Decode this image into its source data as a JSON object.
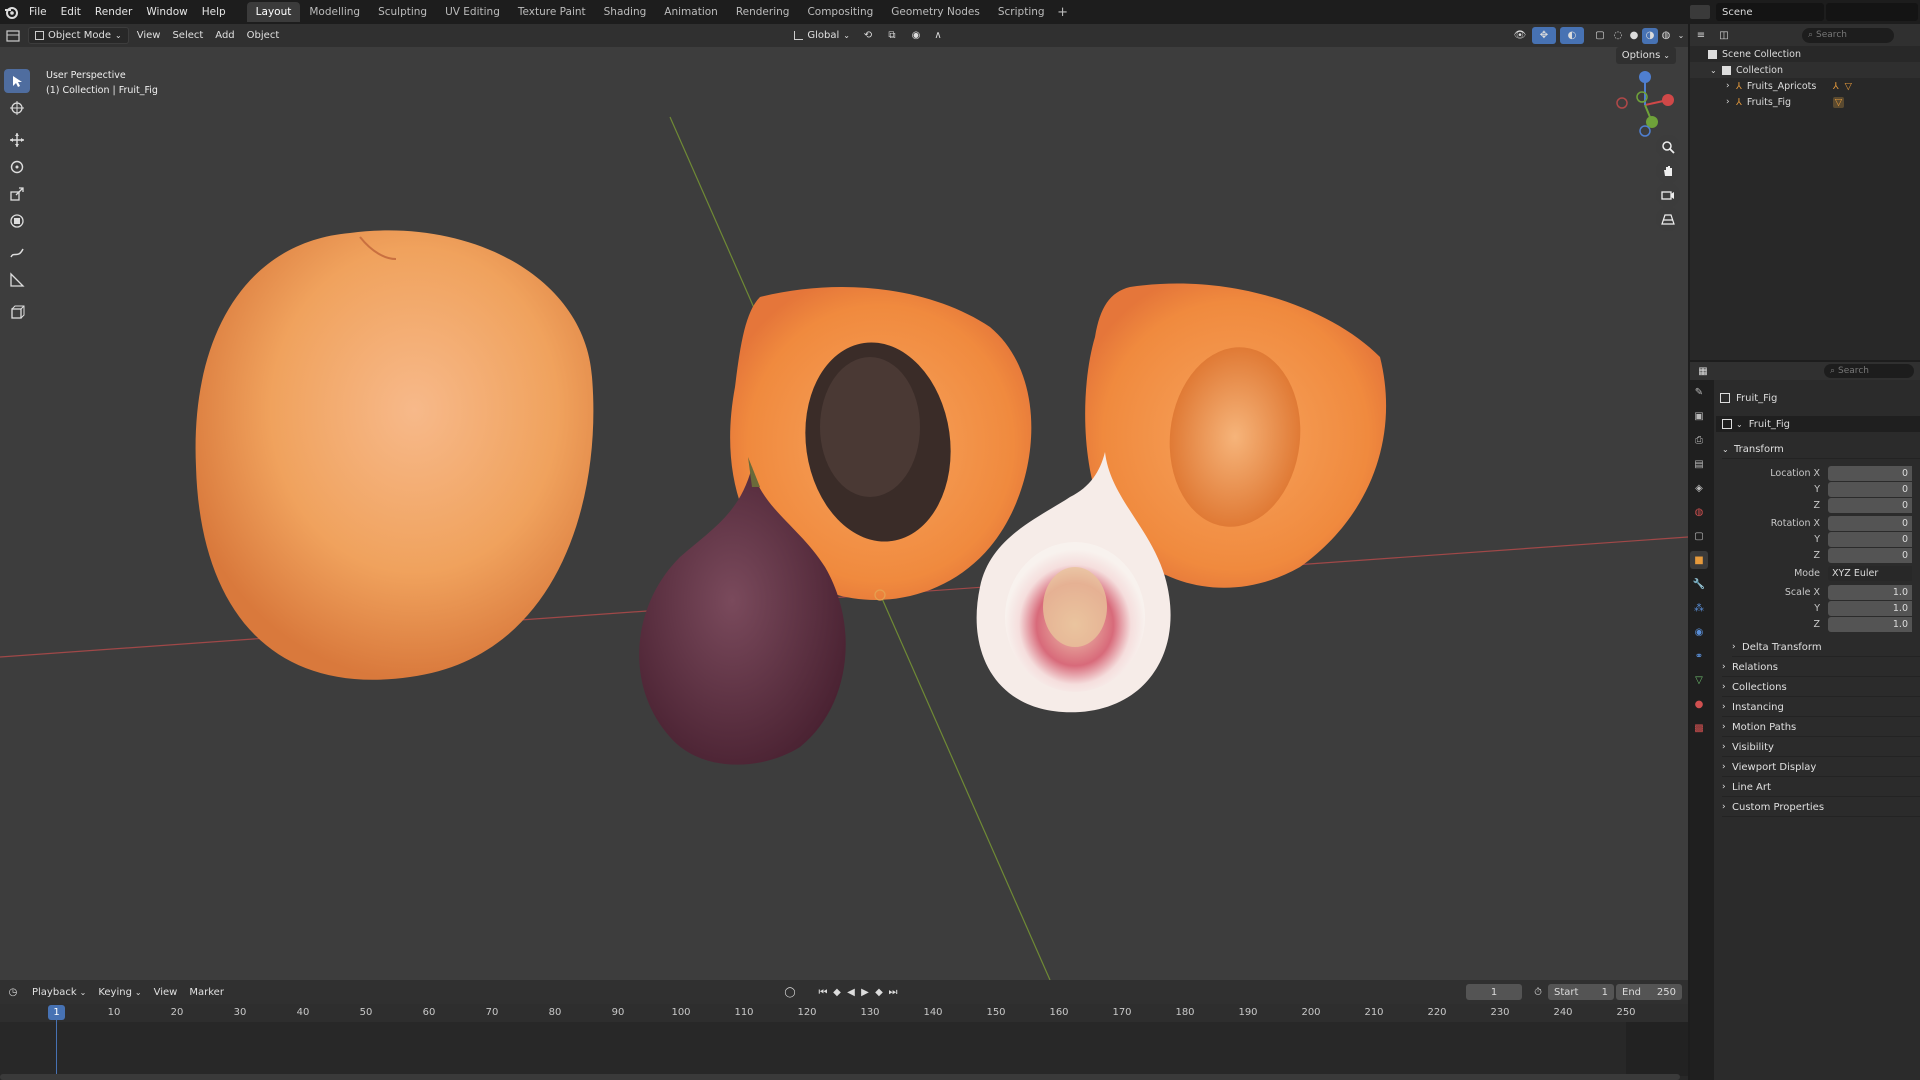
{
  "menu": {
    "items": [
      "File",
      "Edit",
      "Render",
      "Window",
      "Help"
    ]
  },
  "workspaces": [
    "Layout",
    "Modelling",
    "Sculpting",
    "UV Editing",
    "Texture Paint",
    "Shading",
    "Animation",
    "Rendering",
    "Compositing",
    "Geometry Nodes",
    "Scripting"
  ],
  "scene": {
    "label": "Scene"
  },
  "viewport_header": {
    "mode": "Object Mode",
    "menus": [
      "View",
      "Select",
      "Add",
      "Object"
    ],
    "orientation": "Global",
    "options": "Options"
  },
  "viewport": {
    "perspective": "User Perspective",
    "collection": "(1) Collection | Fruit_Fig"
  },
  "colors": {
    "apricot": "#f0a25d",
    "apricot_dark": "#d9793c",
    "pit": "#3a2c28",
    "fig_skin": "#5a2b3b",
    "fig_flesh": "#e8a0a8",
    "x_axis": "#b24a4a",
    "y_axis": "#7a9a3a",
    "accent": "#4772b3"
  },
  "outliner": {
    "search": "Search",
    "root": "Scene Collection",
    "collection": "Collection",
    "objects": [
      "Fruits_Apricots",
      "Fruits_Fig"
    ]
  },
  "properties": {
    "search": "Search",
    "object_name": "Fruit_Fig",
    "data_name": "Fruit_Fig",
    "transform_title": "Transform",
    "rows": [
      {
        "label": "Location X",
        "value": "0"
      },
      {
        "label": "Y",
        "value": "0"
      },
      {
        "label": "Z",
        "value": "0"
      },
      {
        "label": "Rotation X",
        "value": "0"
      },
      {
        "label": "Y",
        "value": "0"
      },
      {
        "label": "Z",
        "value": "0"
      },
      {
        "label": "Mode",
        "value": "XYZ Euler"
      },
      {
        "label": "Scale X",
        "value": "1.0"
      },
      {
        "label": "Y",
        "value": "1.0"
      },
      {
        "label": "Z",
        "value": "1.0"
      }
    ],
    "delta": "Delta Transform",
    "panels": [
      "Relations",
      "Collections",
      "Instancing",
      "Motion Paths",
      "Visibility",
      "Viewport Display",
      "Line Art",
      "Custom Properties"
    ]
  },
  "timeline": {
    "menus": [
      "Playback",
      "Keying",
      "View",
      "Marker"
    ],
    "current_frame": "1",
    "start_label": "Start",
    "start": "1",
    "end_label": "End",
    "end": "250",
    "ruler_frame": "1",
    "ticks": [
      "10",
      "20",
      "30",
      "40",
      "50",
      "60",
      "70",
      "80",
      "90",
      "100",
      "110",
      "120",
      "130",
      "140",
      "150",
      "160",
      "170",
      "180",
      "190",
      "200",
      "210",
      "220",
      "230",
      "240",
      "250"
    ]
  }
}
